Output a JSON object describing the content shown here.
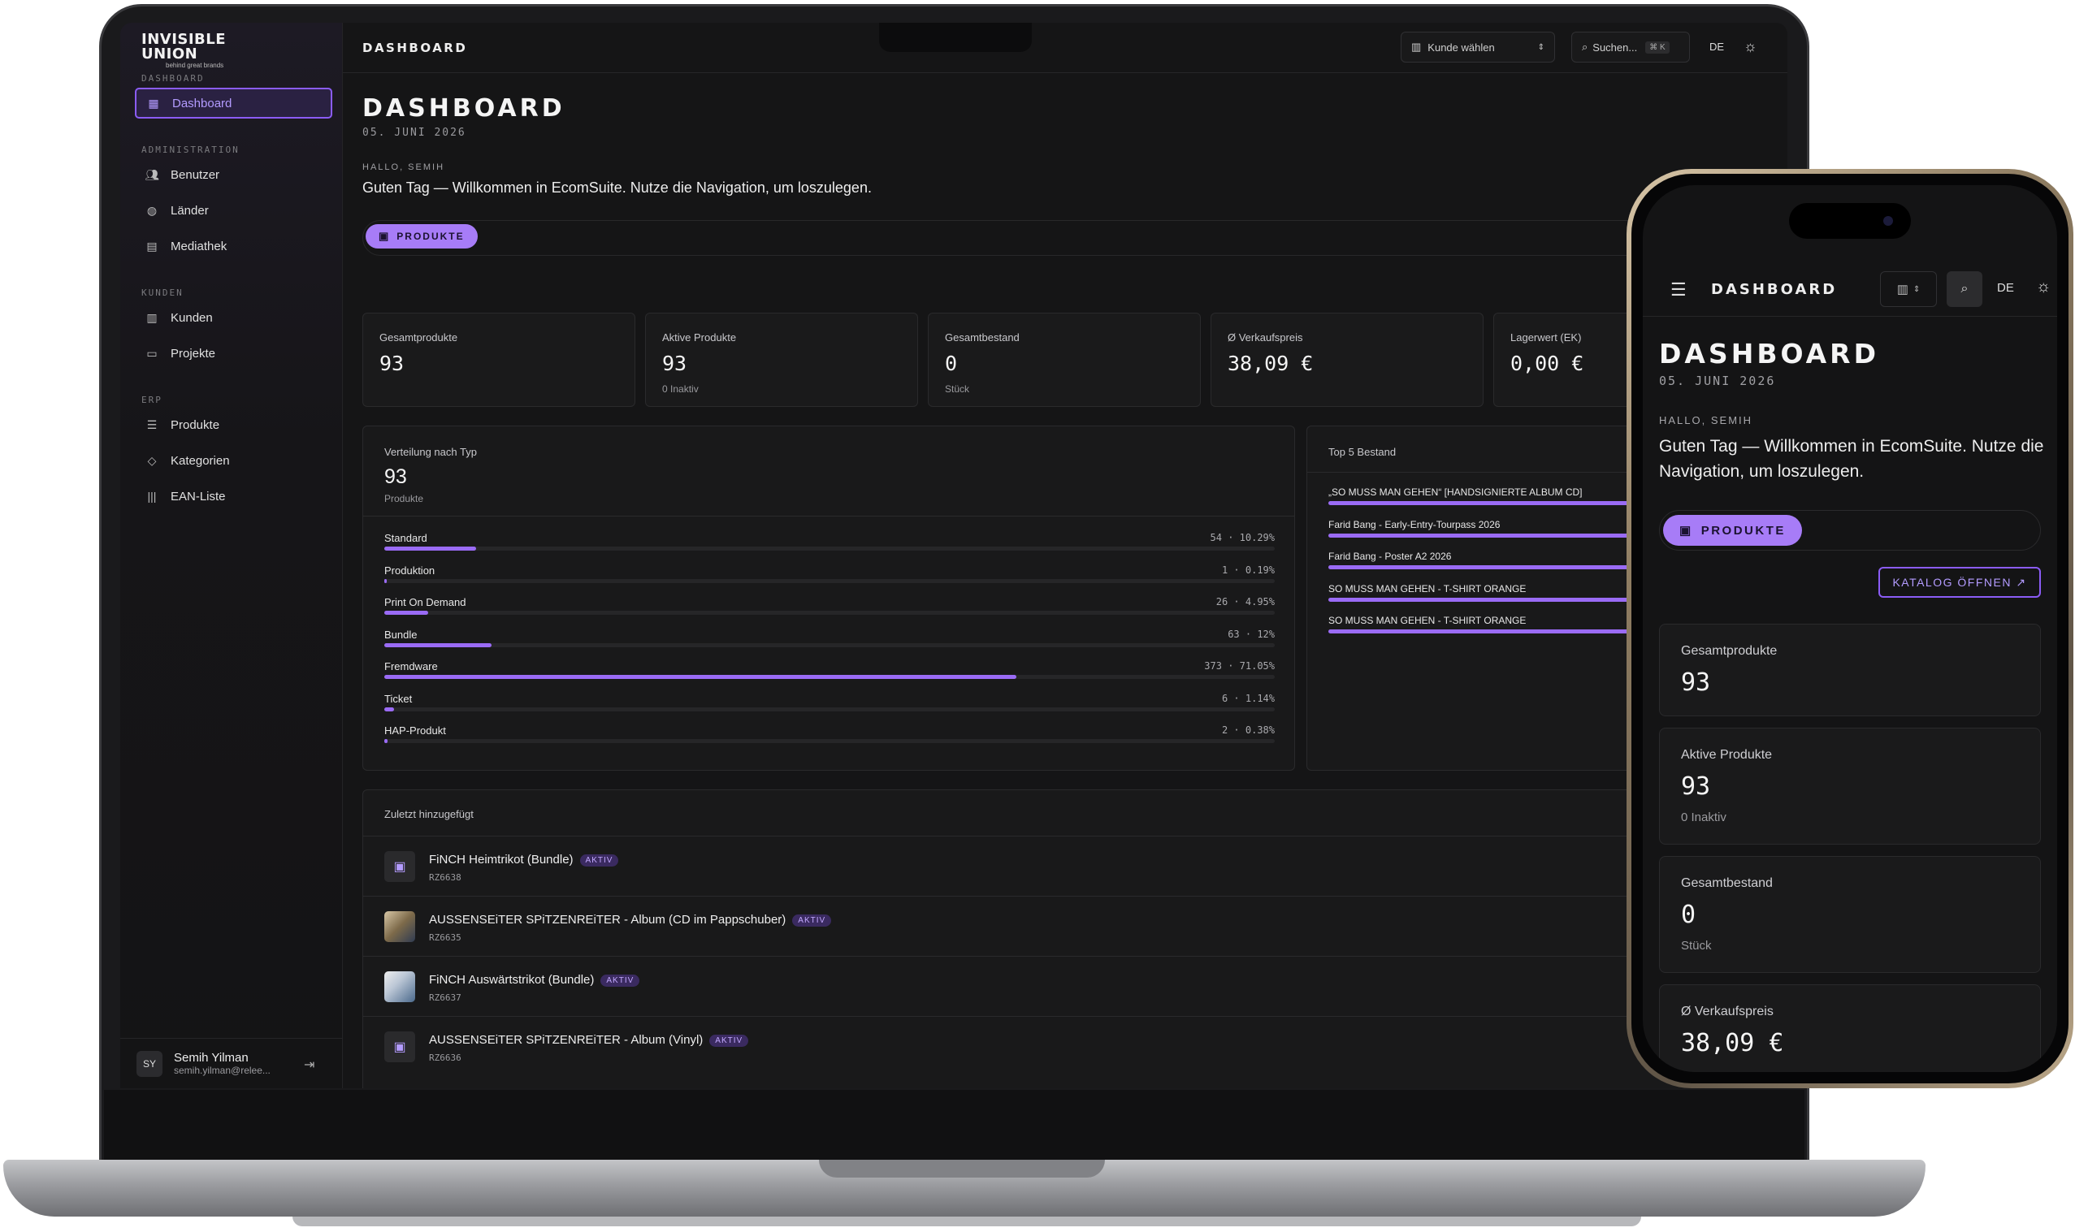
{
  "laptop": {
    "sidebar": {
      "logo_line1": "INVISIBLE",
      "logo_line2": "UNION",
      "logo_tagline": "behind great brands",
      "sections": [
        {
          "label": "DASHBOARD",
          "items": [
            {
              "label": "Dashboard",
              "icon": "grid-icon",
              "active": true
            }
          ]
        },
        {
          "label": "ADMINISTRATION",
          "items": [
            {
              "label": "Benutzer",
              "icon": "users-icon"
            },
            {
              "label": "Länder",
              "icon": "globe-icon"
            },
            {
              "label": "Mediathek",
              "icon": "file-icon"
            }
          ]
        },
        {
          "label": "KUNDEN",
          "items": [
            {
              "label": "Kunden",
              "icon": "building-icon"
            },
            {
              "label": "Projekte",
              "icon": "folder-icon"
            }
          ]
        },
        {
          "label": "ERP",
          "items": [
            {
              "label": "Produkte",
              "icon": "list-icon"
            },
            {
              "label": "Kategorien",
              "icon": "tag-icon"
            },
            {
              "label": "EAN-Liste",
              "icon": "barcode-icon"
            }
          ]
        }
      ],
      "user": {
        "initials": "SY",
        "name": "Semih Yilman",
        "email": "semih.yilman@relee..."
      }
    },
    "topbar": {
      "title": "DASHBOARD",
      "customer_select": "Kunde wählen",
      "search_placeholder": "Suchen...",
      "search_shortcut": "⌘ K",
      "language": "DE"
    },
    "page": {
      "title": "DASHBOARD",
      "date": "05. JUNI 2026",
      "greeting": "HALLO, SEMIH",
      "welcome": "Guten Tag — Willkommen in EcomSuite. Nutze die Navigation, um loszulegen.",
      "products_pill": "PRODUKTE"
    },
    "stats": [
      {
        "label": "Gesamtprodukte",
        "value": "93",
        "sub": ""
      },
      {
        "label": "Aktive Produkte",
        "value": "93",
        "sub": "0 Inaktiv"
      },
      {
        "label": "Gesamtbestand",
        "value": "0",
        "sub": "Stück"
      },
      {
        "label": "Ø Verkaufspreis",
        "value": "38,09 €",
        "sub": ""
      },
      {
        "label": "Lagerwert (EK)",
        "value": "0,00 €",
        "sub": ""
      }
    ],
    "distribution": {
      "title": "Verteilung nach Typ",
      "total": "93",
      "unit": "Produkte",
      "rows": [
        {
          "label": "Standard",
          "value": "54 · 10.29%",
          "fill": 0.145
        },
        {
          "label": "Produktion",
          "value": "1 · 0.19%",
          "fill": 0.003
        },
        {
          "label": "Print On Demand",
          "value": "26 · 4.95%",
          "fill": 0.07
        },
        {
          "label": "Bundle",
          "value": "63 · 12%",
          "fill": 0.17
        },
        {
          "label": "Fremdware",
          "value": "373 · 71.05%",
          "fill": 1.0
        },
        {
          "label": "Ticket",
          "value": "6 · 1.14%",
          "fill": 0.016
        },
        {
          "label": "HAP-Produkt",
          "value": "2 · 0.38%",
          "fill": 0.005
        }
      ]
    },
    "top5": {
      "title": "Top 5 Bestand",
      "items": [
        "„SO MUSS MAN GEHEN“ [HANDSIGNIERTE ALBUM CD]",
        "Farid Bang - Early-Entry-Tourpass 2026",
        "Farid Bang - Poster A2 2026",
        "SO MUSS MAN GEHEN - T-SHIRT ORANGE",
        "SO MUSS MAN GEHEN - T-SHIRT ORANGE"
      ]
    },
    "recent": {
      "title": "Zuletzt hinzugefügt",
      "items": [
        {
          "name": "FiNCH Heimtrikot (Bundle)",
          "sku": "RZ6638",
          "badge": "AKTIV",
          "thumb": "icon"
        },
        {
          "name": "AUSSENSEiTER SPiTZENREiTER - Album (CD im Pappschuber)",
          "sku": "RZ6635",
          "badge": "AKTIV",
          "thumb": "image"
        },
        {
          "name": "FiNCH Auswärtstrikot (Bundle)",
          "sku": "RZ6637",
          "badge": "AKTIV",
          "thumb": "image2"
        },
        {
          "name": "AUSSENSEiTER SPiTZENREiTER - Album (Vinyl)",
          "sku": "RZ6636",
          "badge": "AKTIV",
          "thumb": "icon"
        }
      ]
    }
  },
  "phone": {
    "topbar": {
      "title": "DASHBOARD",
      "language": "DE"
    },
    "page": {
      "title": "DASHBOARD",
      "date": "05. JUNI 2026",
      "greeting": "HALLO, SEMIH",
      "welcome": "Guten Tag — Willkommen in EcomSuite. Nutze die Navigation, um loszulegen.",
      "products_pill": "PRODUKTE",
      "catalog_button": "KATALOG ÖFFNEN ↗"
    },
    "stats": [
      {
        "label": "Gesamtprodukte",
        "value": "93",
        "sub": ""
      },
      {
        "label": "Aktive Produkte",
        "value": "93",
        "sub": "0 Inaktiv"
      },
      {
        "label": "Gesamtbestand",
        "value": "0",
        "sub": "Stück"
      },
      {
        "label": "Ø Verkaufspreis",
        "value": "38,09 €",
        "sub": ""
      }
    ]
  },
  "colors": {
    "accent": "#9a6bf5",
    "pill": "#a77cf7",
    "background": "#151516",
    "card": "#1a1a1b"
  }
}
